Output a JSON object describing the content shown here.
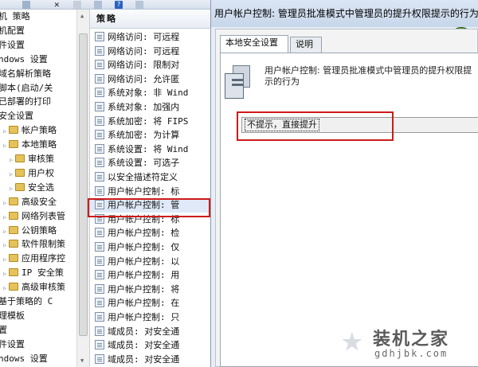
{
  "tree": {
    "items": [
      {
        "label": "机 策略",
        "indent": 0,
        "icon": false
      },
      {
        "label": "机配置",
        "indent": 0,
        "icon": false
      },
      {
        "label": "件设置",
        "indent": 0,
        "icon": false
      },
      {
        "label": "ndows 设置",
        "indent": 0,
        "icon": false
      },
      {
        "label": "域名解析策略",
        "indent": 0,
        "icon": false
      },
      {
        "label": "脚本(启动/关",
        "indent": 0,
        "icon": false
      },
      {
        "label": "已部署的打印",
        "indent": 0,
        "icon": false
      },
      {
        "label": "安全设置",
        "indent": 0,
        "icon": false
      },
      {
        "label": "帐户策略",
        "indent": 1,
        "icon": true
      },
      {
        "label": "本地策略",
        "indent": 1,
        "icon": true
      },
      {
        "label": "审核策",
        "indent": 2,
        "icon": true
      },
      {
        "label": "用户权",
        "indent": 2,
        "icon": true
      },
      {
        "label": "安全选",
        "indent": 2,
        "icon": true
      },
      {
        "label": "高级安全",
        "indent": 1,
        "icon": true
      },
      {
        "label": "网络列表管",
        "indent": 1,
        "icon": true
      },
      {
        "label": "公钥策略",
        "indent": 1,
        "icon": true
      },
      {
        "label": "软件限制策",
        "indent": 1,
        "icon": true
      },
      {
        "label": "应用程序控",
        "indent": 1,
        "icon": true
      },
      {
        "label": "IP 安全策",
        "indent": 1,
        "icon": true
      },
      {
        "label": "高级审核策",
        "indent": 1,
        "icon": true
      },
      {
        "label": "基于策略的 C",
        "indent": 0,
        "icon": false
      },
      {
        "label": "理模板",
        "indent": 0,
        "icon": false
      },
      {
        "label": "置",
        "indent": 0,
        "icon": false
      },
      {
        "label": "件设置",
        "indent": 0,
        "icon": false
      },
      {
        "label": "ndows 设置",
        "indent": 0,
        "icon": false
      }
    ]
  },
  "list": {
    "header": "策略",
    "rows": [
      "网络访问: 可远程",
      "网络访问: 可远程",
      "网络访问: 限制对",
      "网络访问: 允许匿",
      "系统对象: 非 Wind",
      "系统对象: 加强内",
      "系统加密: 将 FIPS",
      "系统加密: 为计算",
      "系统设置: 将 Wind",
      "系统设置: 可选子",
      "以安全描述符定义",
      "用户帐户控制: 标",
      "用户帐户控制: 管",
      "用户帐户控制: 标",
      "用户帐户控制: 检",
      "用户帐户控制: 仅",
      "用户帐户控制: 以",
      "用户帐户控制: 用",
      "用户帐户控制: 将",
      "用户帐户控制: 在",
      "用户帐户控制: 只",
      "域成员: 对安全通",
      "域成员: 对安全通",
      "域成员: 对安全通"
    ],
    "selected_index": 12
  },
  "dialog": {
    "title": "用户帐户控制: 管理员批准模式中管理员的提升权限提示的行为",
    "tabs": [
      "本地安全设置",
      "说明"
    ],
    "description": "用户帐户控制: 管理员批准模式中管理员的提升权限提示的行为",
    "selected_option": "不提示，直接提升"
  },
  "watermark": {
    "title": "装机之家",
    "url": "gdhjbk.com"
  },
  "colors": {
    "highlight_box": "#cc1b1b",
    "selection": "#dfe9f7"
  }
}
